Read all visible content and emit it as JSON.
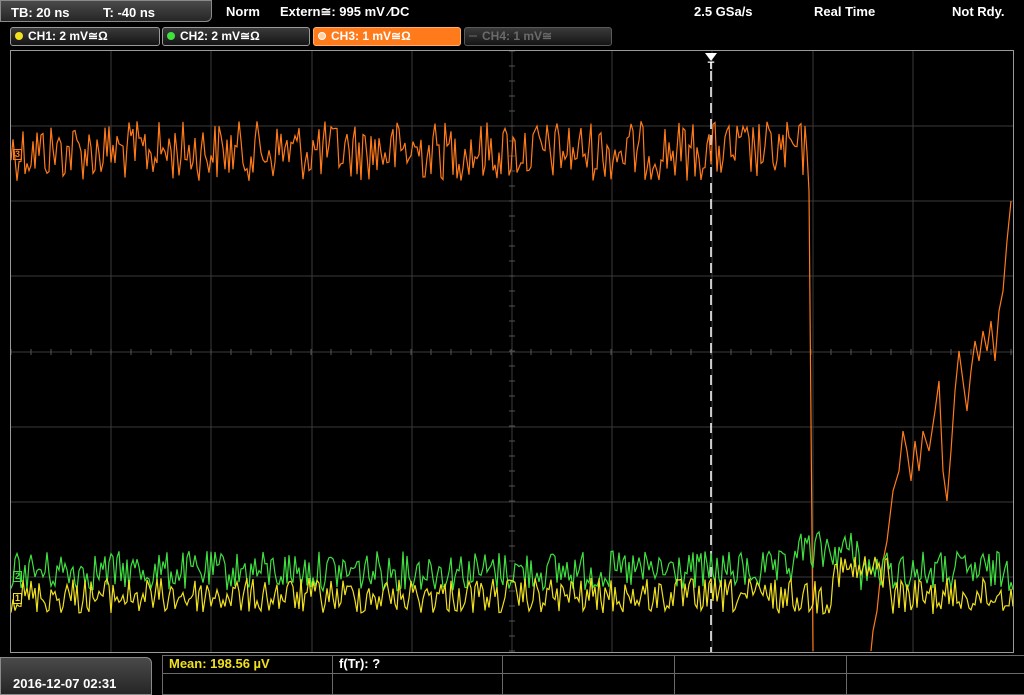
{
  "header": {
    "timebase": "TB: 20 ns",
    "trigger_offset": "T: -40 ns",
    "mode": "Norm",
    "trigger_source": "Extern≅: 995 mV ⁄DC",
    "sample_rate": "2.5 GSa/s",
    "acq_mode": "Real Time",
    "status": "Not Rdy."
  },
  "channels": [
    {
      "label": "CH1: 2 mV≅Ω",
      "color": "#f0e020",
      "state": "on"
    },
    {
      "label": "CH2: 2 mV≅Ω",
      "color": "#40e040",
      "state": "on"
    },
    {
      "label": "CH3: 1 mV≅Ω",
      "color": "#ff7a1a",
      "state": "active"
    },
    {
      "label": "CH4: 1 mV≅",
      "color": "#6a6a6a",
      "state": "off"
    }
  ],
  "markers": {
    "trigger": "T",
    "ch3_level": "3",
    "ch2_level": "2",
    "ch1_level": "1"
  },
  "footer": {
    "datetime": "2016-12-07 02:31",
    "measurement_mean": "Mean: 198.56 µV",
    "measurement_freq": "f(Tr): ?"
  },
  "colors": {
    "ch1": "#f0e020",
    "ch2": "#40e040",
    "ch3": "#ff7a1a",
    "grid": "#3a3a3a"
  }
}
